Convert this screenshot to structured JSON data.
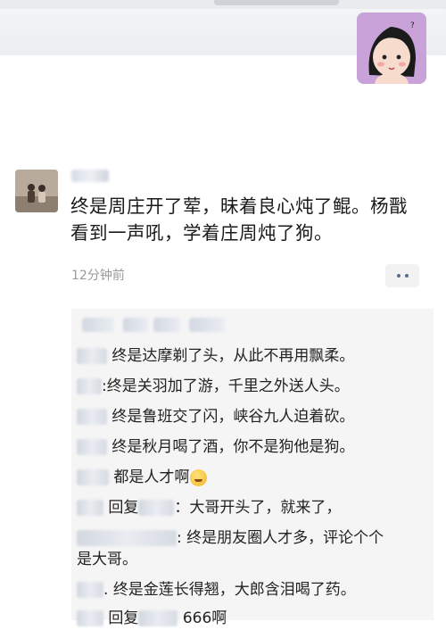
{
  "post": {
    "text_line1": "终是周庄开了荤，昧着良心炖了鲲。杨戬",
    "text_line2": "看到一声吼，学着庄周炖了狗。",
    "time": "12分钟前"
  },
  "comments": [
    {
      "sep": "",
      "text": "终是达摩剃了头，从此不再用飘柔。"
    },
    {
      "sep": ":",
      "text": "终是关羽加了游，千里之外送人头。"
    },
    {
      "sep": "",
      "text": "终是鲁班交了闪，峡谷九人迫着砍。"
    },
    {
      "sep": "",
      "text": "终是秋月喝了酒，你不是狗他是狗。"
    },
    {
      "sep": "",
      "text": "都是人才啊"
    },
    {
      "reply_word": "回复",
      "text": "：大哥开头了，就来了，"
    },
    {
      "sep": ":",
      "text": "终是朋友圈人才多，评论个个",
      "wrap": "是大哥。"
    },
    {
      "sep": ".",
      "text": "终是金莲长得翘，大郎含泪喝了药。"
    },
    {
      "reply_word": "回复",
      "text": "666啊"
    }
  ]
}
